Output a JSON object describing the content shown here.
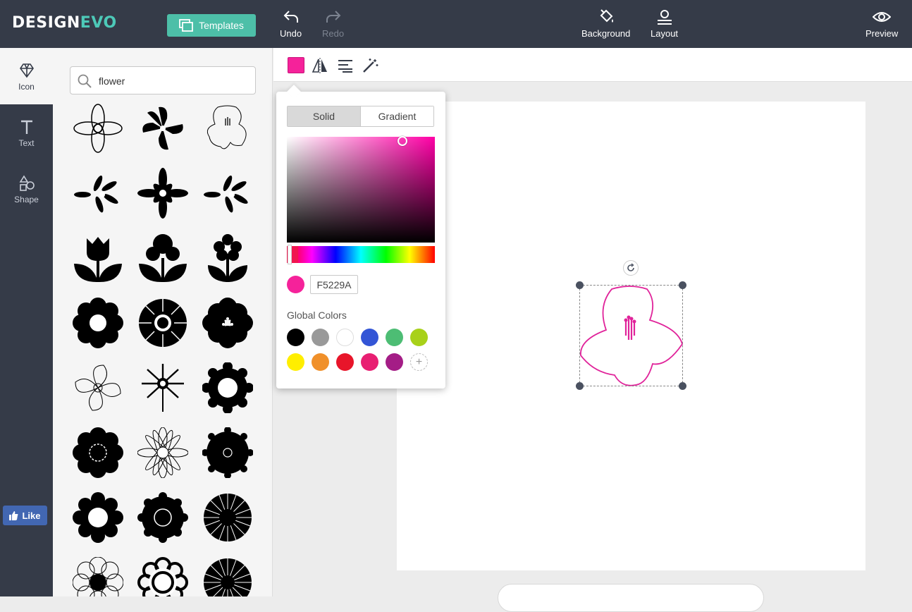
{
  "app": {
    "logo_part1": "DESIGN",
    "logo_part2": "EVO"
  },
  "header": {
    "templates_label": "Templates",
    "undo_label": "Undo",
    "redo_label": "Redo",
    "background_label": "Background",
    "layout_label": "Layout",
    "preview_label": "Preview"
  },
  "leftnav": {
    "items": [
      {
        "label": "Icon",
        "icon": "diamond-icon",
        "active": true
      },
      {
        "label": "Text",
        "icon": "text-t-icon",
        "active": false
      },
      {
        "label": "Shape",
        "icon": "shapes-icon",
        "active": false
      }
    ],
    "like_label": "Like"
  },
  "search": {
    "value": "flower"
  },
  "icon_results": [
    "lotus-outline-icon",
    "pinwheel-flower-icon",
    "lily-outline-icon",
    "branch-leaves-left-icon",
    "eight-petal-flower-icon",
    "branch-leaves-right-icon",
    "tulip-icon",
    "bud-flower-icon",
    "stem-flower-icon",
    "daisy-hole-icon",
    "sunflower-icon",
    "dotted-flower-icon",
    "spiral-flower-outline-icon",
    "stemmed-daisy-icon",
    "gear-flower-icon",
    "dashed-flower-icon",
    "outline-daisy-icon",
    "sunburst-flower-icon",
    "ring-flower-icon",
    "round-petal-flower-icon",
    "spiky-daisy-icon",
    "outline-petal-flower-icon",
    "ring-outline-flower-icon",
    "dense-petal-flower-icon"
  ],
  "toolbar": {
    "fill_color": "#f5229a",
    "tools": [
      "flip-horizontal-icon",
      "align-icon",
      "magic-wand-icon"
    ]
  },
  "color_picker": {
    "tab_solid": "Solid",
    "tab_gradient": "Gradient",
    "active_tab": "Solid",
    "hex_value": "F5229A",
    "current_color": "#f5229a",
    "global_colors_label": "Global Colors",
    "global_colors": [
      "#000000",
      "#999999",
      "#ffffff",
      "#3355d6",
      "#4dbd74",
      "#a8d11a",
      "#ffee00",
      "#f0902a",
      "#e8152a",
      "#e81f72",
      "#a41d86"
    ]
  },
  "canvas": {
    "selected_icon": "lily-outline-icon",
    "icon_color": "#e0239a"
  }
}
